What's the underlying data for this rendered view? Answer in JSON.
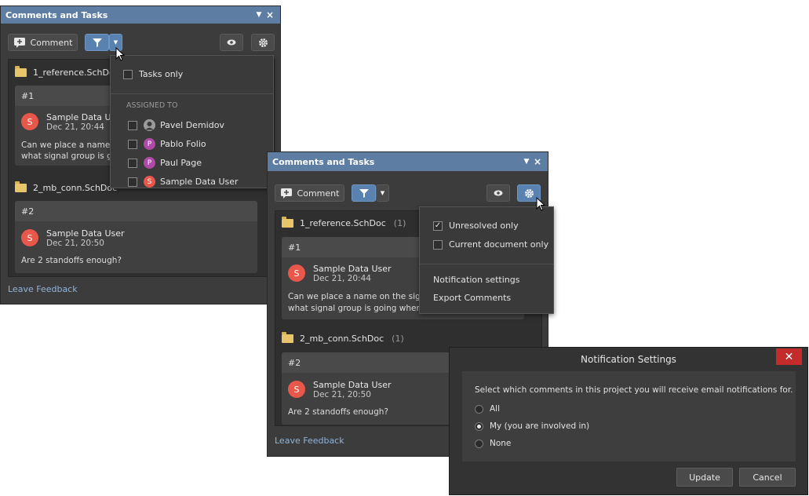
{
  "panel1": {
    "title": "Comments and Tasks",
    "comment_btn": "Comment",
    "docs": [
      {
        "name": "1_reference.SchDoc"
      },
      {
        "name": "2_mb_conn.SchDoc"
      }
    ],
    "cards": [
      {
        "id": "#1",
        "avatar": "S",
        "user": "Sample Data Us",
        "date": "Dec 21, 20:44",
        "line1": "Can we place a name o",
        "line2": "what signal group is goi"
      },
      {
        "id": "#2",
        "avatar": "S",
        "user": "Sample Data User",
        "date": "Dec 21, 20:50",
        "line1": "Are 2 standoffs enough?"
      }
    ],
    "feedback": "Leave Feedback"
  },
  "filter_menu": {
    "tasks_only": "Tasks only",
    "assigned_header": "ASSIGNED TO",
    "people": [
      {
        "name": "Pavel Demidov",
        "initial": "",
        "color": "#8a8a8a"
      },
      {
        "name": "Pablo Folio",
        "initial": "P",
        "color": "#b04aa8"
      },
      {
        "name": "Paul Page",
        "initial": "P",
        "color": "#b04aa8"
      },
      {
        "name": "Sample Data User",
        "initial": "S",
        "color": "#e8584a"
      }
    ]
  },
  "panel2": {
    "title": "Comments and Tasks",
    "comment_btn": "Comment",
    "docs": [
      {
        "name": "1_reference.SchDoc",
        "count": "(1)"
      },
      {
        "name": "2_mb_conn.SchDoc",
        "count": "(1)"
      }
    ],
    "cards": [
      {
        "id": "#1",
        "avatar": "S",
        "user": "Sample Data User",
        "date": "Dec 21, 20:44",
        "line1": "Can we place a name on the signal",
        "line2": "what signal group is going where"
      },
      {
        "id": "#2",
        "avatar": "S",
        "user": "Sample Data User",
        "date": "Dec 21, 20:50",
        "line1": "Are 2 standoffs enough?"
      }
    ],
    "feedback": "Leave Feedback"
  },
  "settings_menu": {
    "unresolved_only": "Unresolved only",
    "current_doc_only": "Current document only",
    "notification_settings": "Notification settings",
    "export_comments": "Export Comments"
  },
  "notification_dialog": {
    "title": "Notification Settings",
    "prompt": "Select which comments in this project you will receive email notifications for.",
    "options": [
      "All",
      "My (you are involved in)",
      "None"
    ],
    "selected": "My (you are involved in)",
    "update": "Update",
    "cancel": "Cancel"
  },
  "colors": {
    "titlebar": "#5d7ea2",
    "accent_blue": "#5a82b0",
    "close_red": "#c42b2b",
    "avatar_red": "#e8584a"
  }
}
